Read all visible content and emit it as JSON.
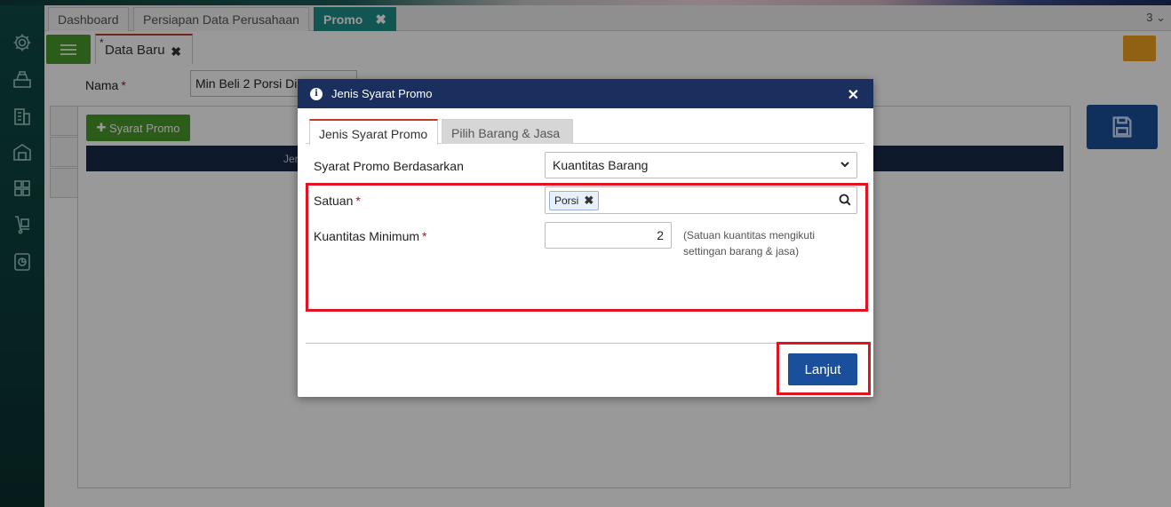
{
  "window": {
    "tabs": [
      {
        "label": "Dashboard"
      },
      {
        "label": "Persiapan Data Perusahaan"
      },
      {
        "label": "Promo",
        "close": "✖"
      }
    ],
    "tab_count": "3"
  },
  "editor": {
    "subtab_marker": "*",
    "subtab_label": "Data Baru",
    "subtab_close": "✖",
    "nama_label": "Nama",
    "required_mark": "*",
    "nama_value": "Min Beli 2 Porsi Di",
    "syarat_button": "Syarat Promo",
    "grid_header_partial": "Jen"
  },
  "modal": {
    "title": "Jenis Syarat Promo",
    "close": "✕",
    "info_glyph": "i",
    "tabs": [
      {
        "label": "Jenis Syarat Promo"
      },
      {
        "label": "Pilih Barang & Jasa"
      }
    ],
    "fields": {
      "basis_label": "Syarat Promo Berdasarkan",
      "basis_value": "Kuantitas Barang",
      "satuan_label": "Satuan",
      "satuan_chip": "Porsi",
      "satuan_chip_remove": "✖",
      "qty_label": "Kuantitas Minimum",
      "qty_value": "2",
      "qty_hint": "(Satuan kuantitas mengikuti settingan barang & jasa)"
    },
    "next_button": "Lanjut"
  },
  "colors": {
    "accent_teal": "#1d8f8a",
    "primary_blue": "#1a4f9c",
    "modal_header": "#1a2f5e",
    "highlight_red": "#e0141e",
    "green": "#4a9a2c"
  }
}
